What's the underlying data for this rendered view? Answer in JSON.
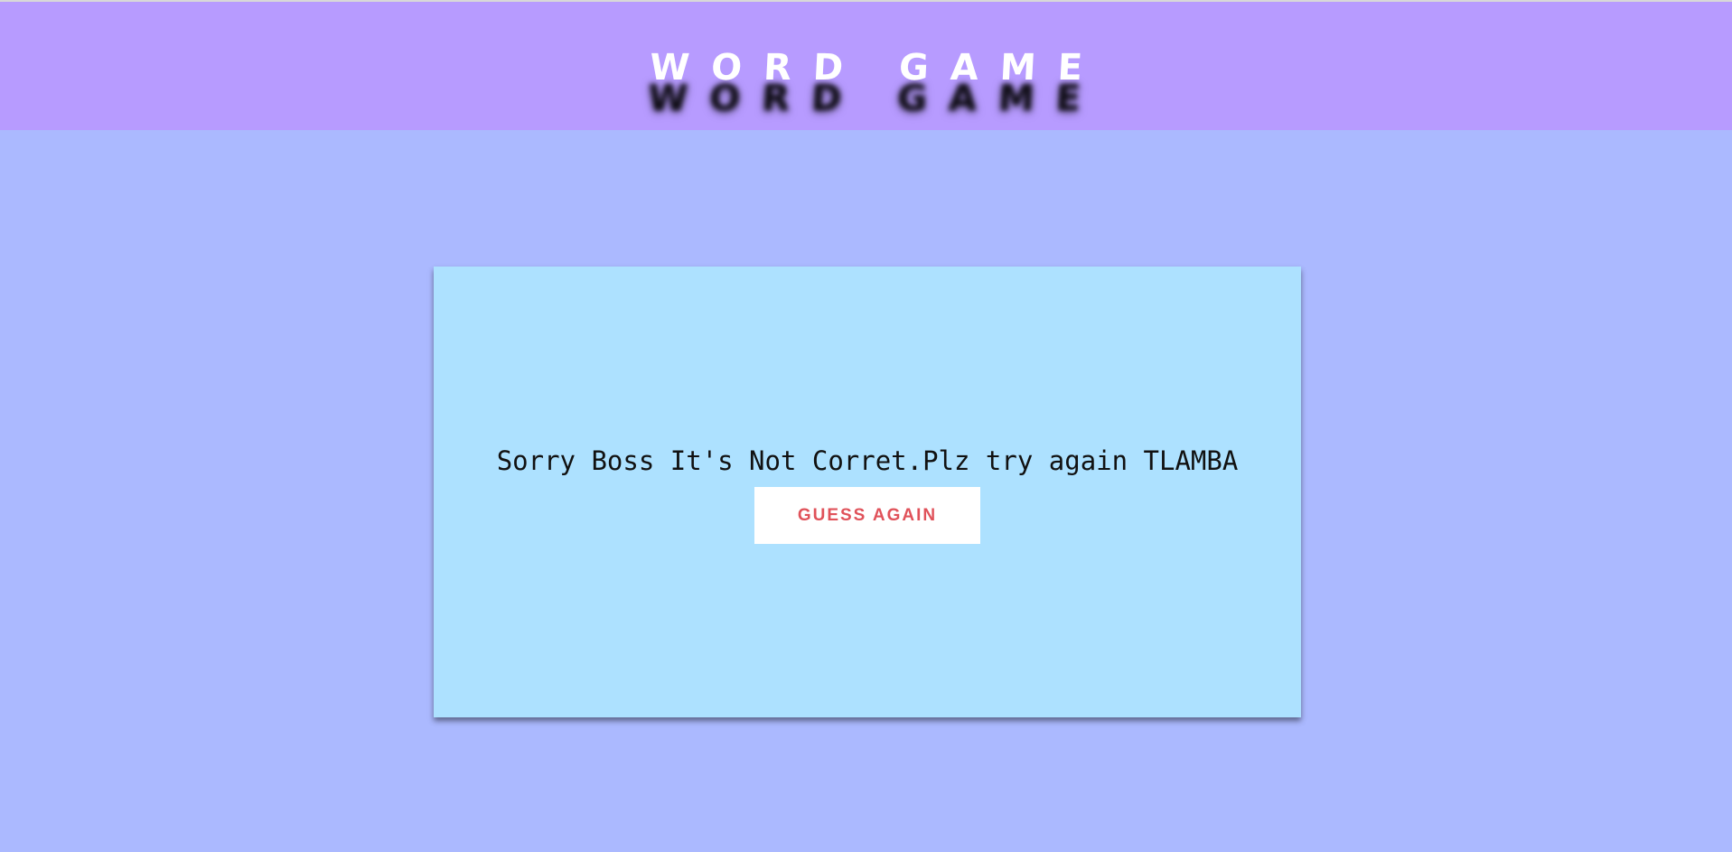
{
  "header": {
    "title": "WORD GAME"
  },
  "result": {
    "message": "Sorry Boss It's Not Corret.Plz try again TLAMBA",
    "button_label": "GUESS AGAIN"
  },
  "colors": {
    "header_bg": "#b79bff",
    "page_bg": "#abb9ff",
    "card_bg": "#ade1ff",
    "button_text": "#e0525a"
  }
}
